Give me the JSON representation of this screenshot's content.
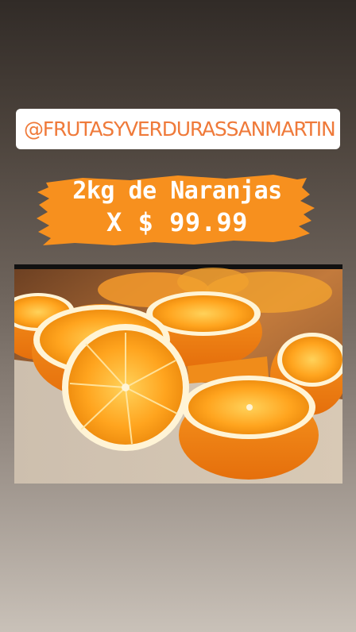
{
  "story": {
    "handle": "@FRUTASYVERDURASSANMARTIN",
    "promo_line1": "2kg de Naranjas",
    "promo_line2": "X $ 99.99",
    "photo_subject": "halved-oranges-on-cutting-board",
    "colors": {
      "accent_orange": "#f7901e",
      "handle_text": "#ef7a3a",
      "tag_background": "#ffffff",
      "promo_text": "#ffffff"
    }
  }
}
